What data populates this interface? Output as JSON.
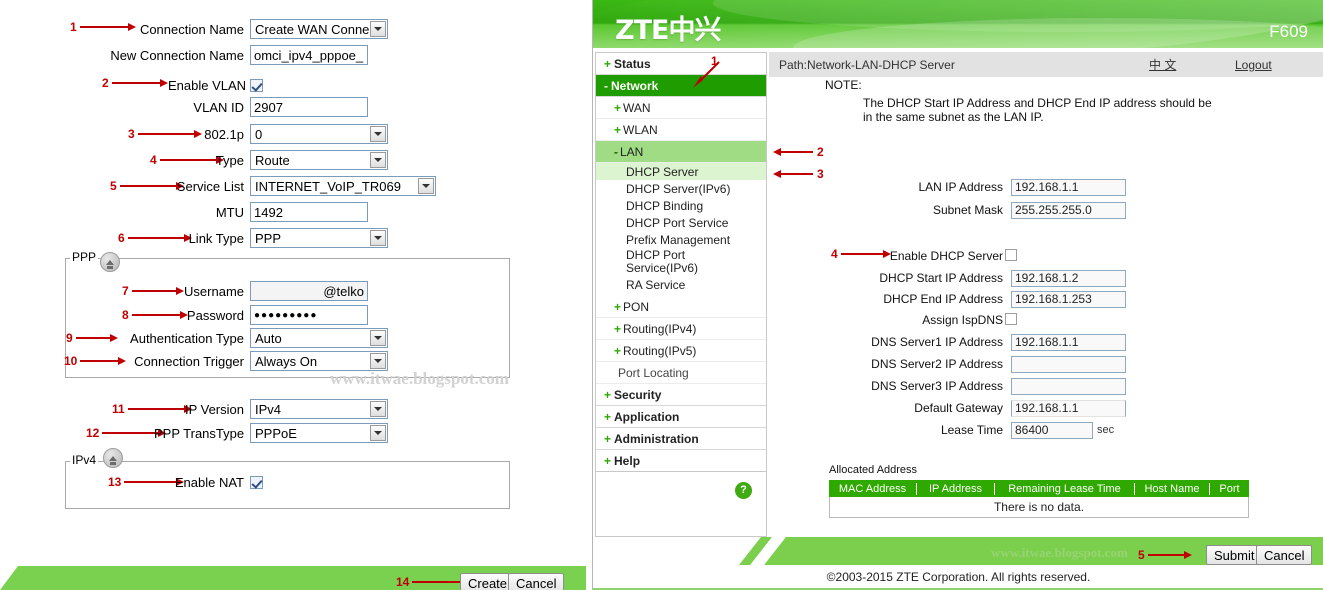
{
  "left_form": {
    "rows": [
      {
        "anno": "1",
        "label": "Connection Name",
        "type": "select",
        "value": "Create WAN Conne"
      },
      {
        "anno": "",
        "label": "New Connection Name",
        "type": "text",
        "value": "omci_ipv4_pppoe_"
      },
      {
        "anno": "2",
        "label": "Enable VLAN",
        "type": "checkbox",
        "value": "checked"
      },
      {
        "anno": "",
        "label": "VLAN ID",
        "type": "text",
        "value": "2907"
      },
      {
        "anno": "3",
        "label": "802.1p",
        "type": "select",
        "value": "0"
      },
      {
        "anno": "4",
        "label": "Type",
        "type": "select",
        "value": "Route"
      },
      {
        "anno": "5",
        "label": "Service List",
        "type": "select",
        "value": "INTERNET_VoIP_TR069"
      },
      {
        "anno": "",
        "label": "MTU",
        "type": "text",
        "value": "1492"
      },
      {
        "anno": "6",
        "label": "Link Type",
        "type": "select",
        "value": "PPP"
      }
    ],
    "ppp_group": {
      "title": "PPP",
      "rows": [
        {
          "anno": "7",
          "label": "Username",
          "type": "text",
          "value": "@telko"
        },
        {
          "anno": "8",
          "label": "Password",
          "type": "text",
          "value": "●●●●●●●●●"
        },
        {
          "anno": "9",
          "label": "Authentication Type",
          "type": "select",
          "value": "Auto"
        },
        {
          "anno": "10",
          "label": "Connection Trigger",
          "type": "select",
          "value": "Always On"
        }
      ],
      "watermark": "www.itwae.blogspot.com"
    },
    "mid_rows": [
      {
        "anno": "11",
        "label": "IP Version",
        "type": "select",
        "value": "IPv4"
      },
      {
        "anno": "12",
        "label": "PPP TransType",
        "type": "select",
        "value": "PPPoE"
      }
    ],
    "ipv4_group": {
      "title": "IPv4",
      "rows": [
        {
          "anno": "13",
          "label": "Enable NAT",
          "type": "checkbox",
          "value": "checked"
        }
      ]
    },
    "footer": {
      "anno": "14",
      "create_label": "Create",
      "cancel_label": "Cancel"
    }
  },
  "router": {
    "brand": "ZTE中兴",
    "model": "F609",
    "pathbar": {
      "path": "Path:Network-LAN-DHCP Server",
      "lang_link": "中 文",
      "logout_link": "Logout"
    },
    "sidebar": {
      "items": [
        {
          "level": "top",
          "prefix": "+",
          "label": "Status",
          "state": "normal"
        },
        {
          "level": "top",
          "prefix": "-",
          "label": "Network",
          "state": "active",
          "anno": "1"
        },
        {
          "level": "sub",
          "prefix": "+",
          "label": "WAN",
          "state": "normal"
        },
        {
          "level": "sub",
          "prefix": "+",
          "label": "WLAN",
          "state": "normal"
        },
        {
          "level": "sub",
          "prefix": "-",
          "label": "LAN",
          "state": "open",
          "anno": "2"
        },
        {
          "level": "leaf",
          "prefix": "",
          "label": "DHCP Server",
          "state": "selected",
          "anno": "3"
        },
        {
          "level": "leaf",
          "prefix": "",
          "label": "DHCP Server(IPv6)",
          "state": "normal"
        },
        {
          "level": "leaf",
          "prefix": "",
          "label": "DHCP Binding",
          "state": "normal"
        },
        {
          "level": "leaf",
          "prefix": "",
          "label": "DHCP Port Service",
          "state": "normal"
        },
        {
          "level": "leaf",
          "prefix": "",
          "label": "Prefix Management",
          "state": "normal"
        },
        {
          "level": "leaf",
          "prefix": "",
          "label": "DHCP Port Service(IPv6)",
          "state": "normal"
        },
        {
          "level": "leaf",
          "prefix": "",
          "label": "RA Service",
          "state": "normal"
        },
        {
          "level": "sub",
          "prefix": "+",
          "label": "PON",
          "state": "normal"
        },
        {
          "level": "sub",
          "prefix": "+",
          "label": "Routing(IPv4)",
          "state": "normal"
        },
        {
          "level": "sub",
          "prefix": "+",
          "label": "Routing(IPv5)",
          "state": "normal"
        },
        {
          "level": "sub",
          "prefix": "",
          "label": "Port Locating",
          "state": "normal"
        },
        {
          "level": "top",
          "prefix": "+",
          "label": "Security",
          "state": "normal"
        },
        {
          "level": "top",
          "prefix": "+",
          "label": "Application",
          "state": "normal"
        },
        {
          "level": "top",
          "prefix": "+",
          "label": "Administration",
          "state": "normal"
        },
        {
          "level": "top",
          "prefix": "+",
          "label": "Help",
          "state": "normal"
        }
      ],
      "help_icon_label": "?"
    },
    "content": {
      "note_label": "NOTE:",
      "note_line1": "The DHCP Start IP Address and DHCP End IP address should be",
      "note_line2": "in the same subnet as the LAN IP.",
      "fields": [
        {
          "label": "LAN IP Address",
          "type": "text",
          "value": "192.168.1.1"
        },
        {
          "label": "Subnet Mask",
          "type": "text",
          "value": "255.255.255.0"
        },
        {
          "label": "Enable DHCP Server",
          "type": "checkbox",
          "value": "unchecked",
          "anno": "4"
        },
        {
          "label": "DHCP Start IP Address",
          "type": "text",
          "value": "192.168.1.2"
        },
        {
          "label": "DHCP End IP Address",
          "type": "text",
          "value": "192.168.1.253"
        },
        {
          "label": "Assign IspDNS",
          "type": "checkbox",
          "value": "unchecked"
        },
        {
          "label": "DNS Server1 IP Address",
          "type": "text",
          "value": "192.168.1.1"
        },
        {
          "label": "DNS Server2 IP Address",
          "type": "text",
          "value": ""
        },
        {
          "label": "DNS Server3 IP Address",
          "type": "text",
          "value": ""
        },
        {
          "label": "Default Gateway",
          "type": "text",
          "value": "192.168.1.1"
        },
        {
          "label": "Lease Time",
          "type": "text",
          "value": "86400",
          "suffix": "sec"
        }
      ],
      "allocated": {
        "caption": "Allocated Address",
        "columns": [
          "MAC Address",
          "IP Address",
          "Remaining Lease Time",
          "Host Name",
          "Port"
        ],
        "empty_text": "There is no data."
      }
    },
    "footer": {
      "anno": "5",
      "submit_label": "Submit",
      "cancel_label": "Cancel",
      "watermark": "www.itwae.blogspot.com",
      "copyright": "©2003-2015 ZTE Corporation. All rights reserved."
    }
  },
  "colors": {
    "brand_green": "#2fa800",
    "nav_active": "#1f9c00",
    "nav_open": "#9fdc84",
    "nav_selected": "#ddf4d1",
    "annotation_red": "#c00000",
    "footer_green": "#7ccf4c"
  }
}
